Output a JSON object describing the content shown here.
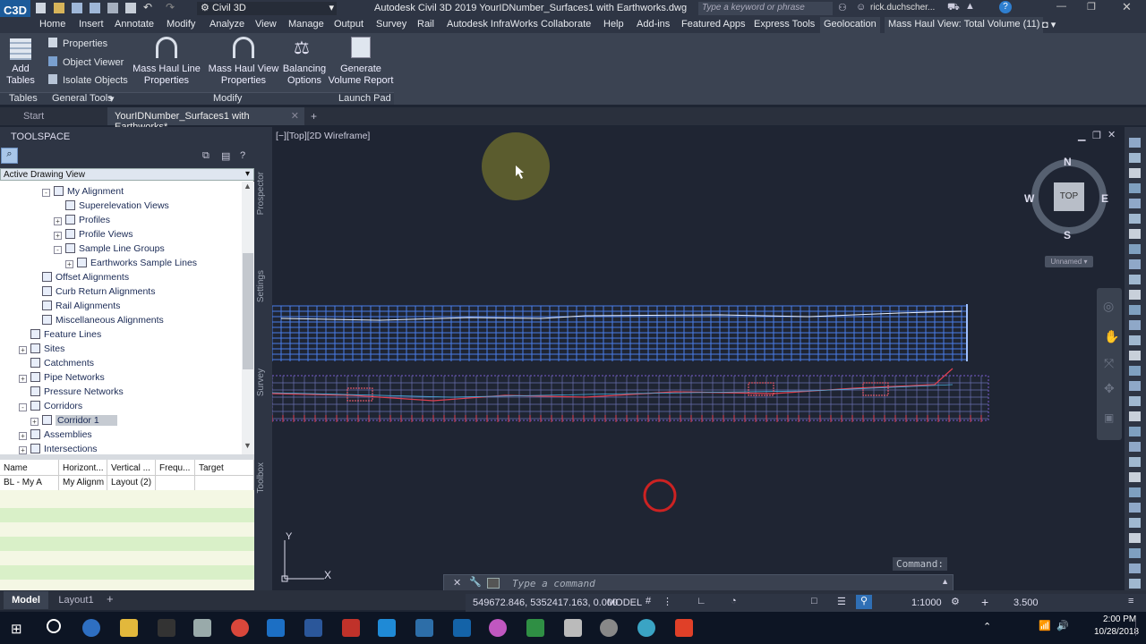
{
  "titlebar": {
    "workspace": "Civil 3D",
    "title": "Autodesk Civil 3D 2019   YourIDNumber_Surfaces1 with Earthworks.dwg",
    "search_placeholder": "Type a keyword or phrase",
    "user": "rick.duchscher..."
  },
  "app_logo": "C3D",
  "menu": [
    "Home",
    "Insert",
    "Annotate",
    "Modify",
    "Analyze",
    "View",
    "Manage",
    "Output",
    "Survey",
    "Rail",
    "Autodesk InfraWorks",
    "Collaborate",
    "Help",
    "Add-ins",
    "Featured Apps",
    "Express Tools",
    "Geolocation",
    "Mass Haul View: Total Volume (11)"
  ],
  "ribbon": {
    "add_tables": "Add\nTables",
    "properties": "Properties",
    "object_viewer": "Object Viewer",
    "isolate_objects": "Isolate Objects",
    "mass_haul_line_properties": "Mass Haul Line\nProperties",
    "mass_haul_view_properties": "Mass Haul View\nProperties",
    "balancing_options": "Balancing\nOptions",
    "generate_volume_report": "Generate\nVolume Report",
    "panels": {
      "tables": "Tables",
      "general_tools": "General Tools",
      "modify": "Modify",
      "launch_pad": "Launch Pad"
    }
  },
  "file_tabs": [
    "Start",
    "YourIDNumber_Surfaces1 with Earthworks*"
  ],
  "toolspace": {
    "title": "TOOLSPACE",
    "view_combo": "Active Drawing View",
    "side_tabs": [
      "Prospector",
      "Settings",
      "Survey",
      "Toolbox"
    ],
    "tree": [
      {
        "label": "My Alignment",
        "indent": 3,
        "expander": "-"
      },
      {
        "label": "Superelevation Views",
        "indent": 4,
        "expander": ""
      },
      {
        "label": "Profiles",
        "indent": 4,
        "expander": "+"
      },
      {
        "label": "Profile Views",
        "indent": 4,
        "expander": "+"
      },
      {
        "label": "Sample Line Groups",
        "indent": 4,
        "expander": "-"
      },
      {
        "label": "Earthworks Sample Lines",
        "indent": 5,
        "expander": "+"
      },
      {
        "label": "Offset Alignments",
        "indent": 2,
        "expander": ""
      },
      {
        "label": "Curb Return Alignments",
        "indent": 2,
        "expander": ""
      },
      {
        "label": "Rail Alignments",
        "indent": 2,
        "expander": ""
      },
      {
        "label": "Miscellaneous Alignments",
        "indent": 2,
        "expander": ""
      },
      {
        "label": "Feature Lines",
        "indent": 1,
        "expander": ""
      },
      {
        "label": "Sites",
        "indent": 1,
        "expander": "+"
      },
      {
        "label": "Catchments",
        "indent": 1,
        "expander": ""
      },
      {
        "label": "Pipe Networks",
        "indent": 1,
        "expander": "+"
      },
      {
        "label": "Pressure Networks",
        "indent": 1,
        "expander": ""
      },
      {
        "label": "Corridors",
        "indent": 1,
        "expander": "-"
      },
      {
        "label": "Corridor 1",
        "indent": 2,
        "expander": "+",
        "selected": true
      },
      {
        "label": "Assemblies",
        "indent": 1,
        "expander": "+"
      },
      {
        "label": "Intersections",
        "indent": 1,
        "expander": "+"
      }
    ],
    "grid_headers": [
      "Name",
      "Horizont...",
      "Vertical ...",
      "Frequ...",
      "Target"
    ],
    "grid_row": [
      "BL - My A",
      "My Alignm",
      "Layout (2)",
      "",
      ""
    ]
  },
  "viewport": {
    "label": "[−][Top][2D Wireframe]",
    "viewcube": {
      "n": "N",
      "s": "S",
      "e": "E",
      "w": "W",
      "face": "TOP",
      "ucs": "Unnamed"
    },
    "axis_x": "X",
    "axis_y": "Y"
  },
  "command": {
    "history": "Command:",
    "placeholder": "Type a command"
  },
  "layout_tabs": [
    "Model",
    "Layout1"
  ],
  "status": {
    "coords": "549672.846, 5352417.163, 0.000",
    "model": "MODEL",
    "scale": "1:1000",
    "annoscale": "3.500"
  },
  "taskbar": {
    "time": "2:00 PM",
    "date": "10/28/2018"
  },
  "colors": {
    "accent": "#1f8ad6",
    "viewport_bg": "#1f2533",
    "massHaulGrid": "#4a7de8",
    "profileRed": "#e04050"
  }
}
